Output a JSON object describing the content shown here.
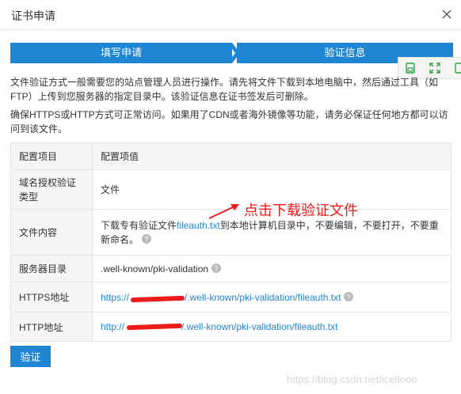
{
  "dialog": {
    "title": "证书申请"
  },
  "steps": [
    {
      "label": "填写申请"
    },
    {
      "label": "验证信息"
    }
  ],
  "instructions": {
    "p1": "文件验证方式一般需要您的站点管理人员进行操作。请先将文件下载到本地电脑中，然后通过工具（如FTP）上传到您服务器的指定目录中。该验证信息在证书签发后可删除。",
    "p2": "确保HTTPS或HTTP方式可正常访问。如果用了CDN或者海外镜像等功能，请务必保证任何地方都可以访问到该文件。"
  },
  "table": {
    "headers": [
      "配置项目",
      "配置项值"
    ],
    "domain_auth": {
      "label": "域名授权验证类型",
      "value": "文件"
    },
    "file_content": {
      "label": "文件内容",
      "prefix": "下载专有验证文件",
      "link": "fileauth.txt",
      "suffix": "到本地计算机目录中，不要编辑，不要打开，不要重新命名。"
    },
    "server_dir": {
      "label": "服务器目录",
      "value": ".well-known/pki-validation"
    },
    "https": {
      "label": "HTTPS地址",
      "prefix": "https://",
      "path": "/.well-known/pki-validation/fileauth.txt"
    },
    "http": {
      "label": "HTTP地址",
      "prefix": "http://",
      "path": "/.well-known/pki-validation/fileauth.txt"
    }
  },
  "annotation": "点击下载验证文件",
  "buttons": {
    "verify": "验证"
  },
  "watermark": "https://blog.csdn.net/icelIooo",
  "colors": {
    "accent": "#1f86d3",
    "annotation_red": "#ee1b1b",
    "tool_green": "#28a745"
  }
}
